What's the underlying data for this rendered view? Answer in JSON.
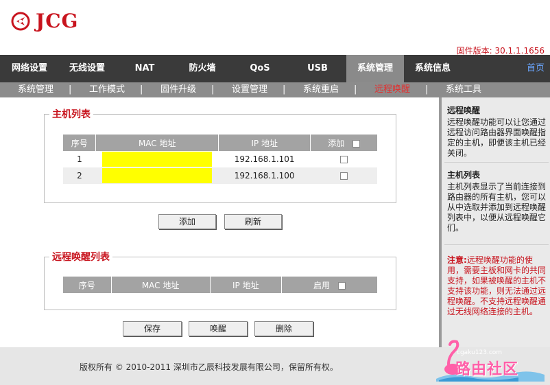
{
  "brand": {
    "name": "JCG",
    "reg": "®"
  },
  "firmware": "固件版本: 30.1.1.1656",
  "nav": {
    "items": [
      "网络设置",
      "无线设置",
      "NAT",
      "防火墙",
      "QoS",
      "USB",
      "系统管理",
      "系统信息"
    ],
    "active": "系统管理",
    "home": "首页"
  },
  "subnav": {
    "items": [
      "系统管理",
      "工作模式",
      "固件升级",
      "设置管理",
      "系统重启",
      "远程唤醒",
      "系统工具"
    ],
    "separator": "|",
    "active": "远程唤醒"
  },
  "host_list": {
    "legend": "主机列表",
    "headers": {
      "index": "序号",
      "mac": "MAC 地址",
      "ip": "IP 地址",
      "add": "添加"
    },
    "rows": [
      {
        "index": "1",
        "mac": "",
        "ip": "192.168.1.101",
        "checked": false
      },
      {
        "index": "2",
        "mac": "",
        "ip": "192.168.1.100",
        "checked": false
      }
    ]
  },
  "host_buttons": {
    "add": "添加",
    "refresh": "刷新"
  },
  "wake_list": {
    "legend": "远程唤醒列表",
    "headers": {
      "index": "序号",
      "mac": "MAC 地址",
      "ip": "IP 地址",
      "enable": "启用"
    }
  },
  "wake_buttons": {
    "save": "保存",
    "wake": "唤醒",
    "delete": "删除"
  },
  "sidebar": {
    "wake_title": "远程唤醒",
    "wake_text": "远程唤醒功能可以让您通过远程访问路由器界面唤醒指定的主机，即便该主机已经关闭。",
    "list_title": "主机列表",
    "list_text": "主机列表显示了当前连接到路由器的所有主机，您可以从中选取并添加到远程唤醒列表中，以便从远程唤醒它们。",
    "note_label": "注意:",
    "note_text": "远程唤醒功能的使用，需要主板和网卡的共同支持，如果被唤醒的主机不支持该功能，则无法通过远程唤醒。不支持远程唤醒通过无线网络连接的主机。"
  },
  "footer": {
    "copyright": "版权所有 © 2010-2011 深圳市乙辰科技发展有限公司，保留所有权。"
  },
  "watermark": {
    "url": "cgaku123.com",
    "text": "路由社区"
  },
  "colors": {
    "accent": "#c8141e",
    "nav_bg": "#3a3a3a",
    "nav_active": "#8a8a8a",
    "subnav_bg": "#8c8c8c",
    "highlight": "#ffff00"
  }
}
